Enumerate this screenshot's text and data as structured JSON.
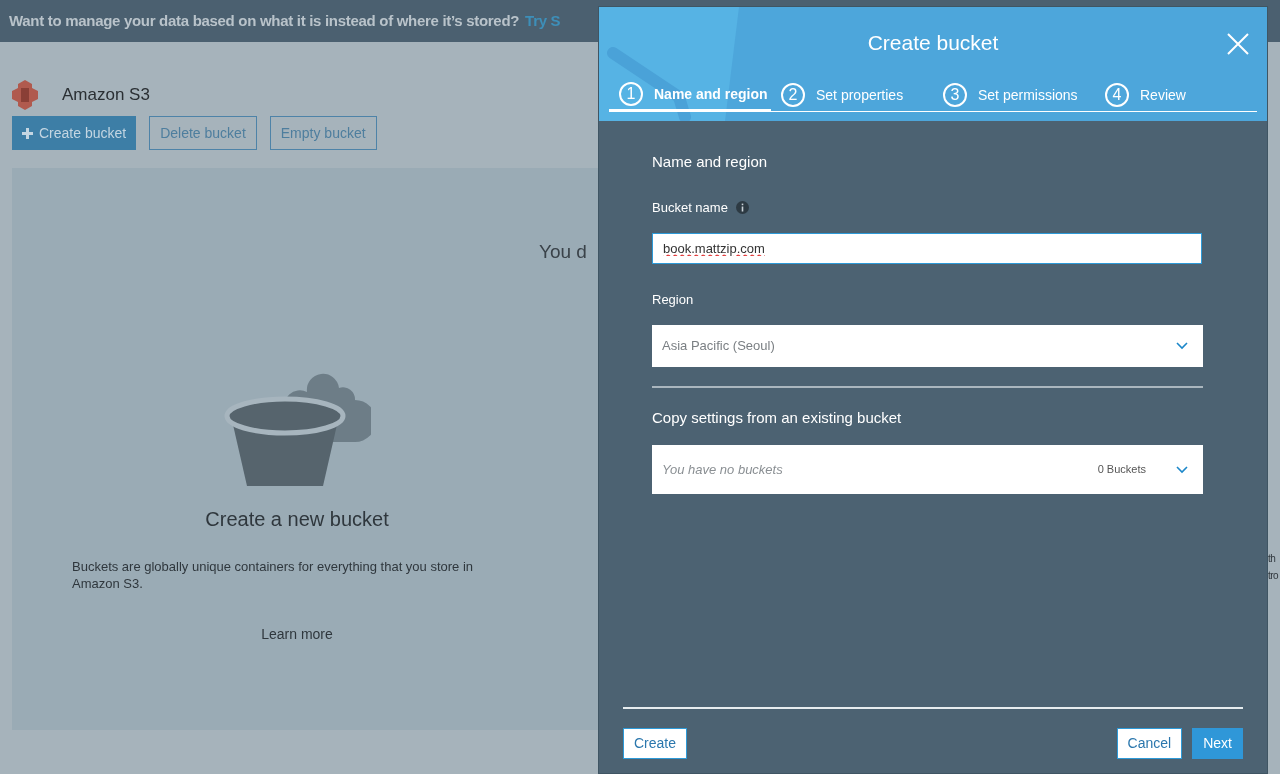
{
  "banner": {
    "text": "Want to manage your data based on what it is instead of where it’s stored?",
    "link": "Try S"
  },
  "service": {
    "title": "Amazon S3"
  },
  "toolbar": [
    {
      "label": "Create bucket",
      "kind": "primary"
    },
    {
      "label": "Delete bucket",
      "kind": "outline"
    },
    {
      "label": "Empty bucket",
      "kind": "outline"
    }
  ],
  "empty_state": {
    "heading": "You d",
    "title": "Create a new bucket",
    "description": "Buckets are globally unique containers for everything that you store in Amazon S3.",
    "link": "Learn more",
    "right_lines": [
      "th",
      "tro"
    ]
  },
  "dialog": {
    "title": "Create bucket",
    "steps": [
      {
        "number": "1",
        "label": "Name and region",
        "selected": true
      },
      {
        "number": "2",
        "label": "Set properties",
        "selected": false
      },
      {
        "number": "3",
        "label": "Set permissions",
        "selected": false
      },
      {
        "number": "4",
        "label": "Review",
        "selected": false
      }
    ],
    "section_title": "Name and region",
    "bucket_name": {
      "label": "Bucket name",
      "value": "book.mattzip.com"
    },
    "region": {
      "label": "Region",
      "value": "Asia Pacific (Seoul)"
    },
    "copy_settings": {
      "title": "Copy settings from an existing bucket",
      "placeholder": "You have no buckets",
      "count": "0 Buckets"
    },
    "buttons": [
      {
        "label": "Create",
        "kind": "secondary"
      },
      {
        "label": "Cancel",
        "kind": "secondary"
      },
      {
        "label": "Next",
        "kind": "primary"
      }
    ]
  }
}
